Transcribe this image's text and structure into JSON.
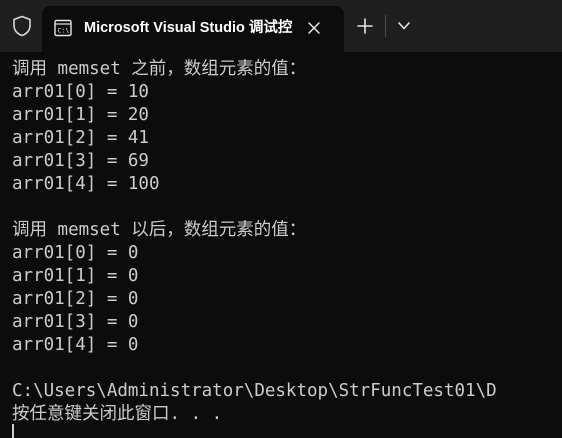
{
  "window": {
    "tab_title": "Microsoft Visual Studio 调试控",
    "icons": {
      "shield": "shield-icon",
      "terminal": "terminal-icon",
      "close": "close-icon",
      "new_tab": "plus-icon",
      "dropdown": "chevron-down-icon"
    }
  },
  "console": {
    "lines": [
      "调用 memset 之前，数组元素的值：",
      "arr01[0] = 10",
      "arr01[1] = 20",
      "arr01[2] = 41",
      "arr01[3] = 69",
      "arr01[4] = 100",
      "",
      "调用 memset 以后，数组元素的值：",
      "arr01[0] = 0",
      "arr01[1] = 0",
      "arr01[2] = 0",
      "arr01[3] = 0",
      "arr01[4] = 0",
      "",
      "C:\\Users\\Administrator\\Desktop\\StrFuncTest01\\D",
      "按任意键关闭此窗口. . ."
    ]
  },
  "colors": {
    "terminal_bg": "#0c0c0c",
    "titlebar_bg": "#1f1f1f",
    "text": "#cccccc",
    "tab_text": "#ffffff"
  }
}
